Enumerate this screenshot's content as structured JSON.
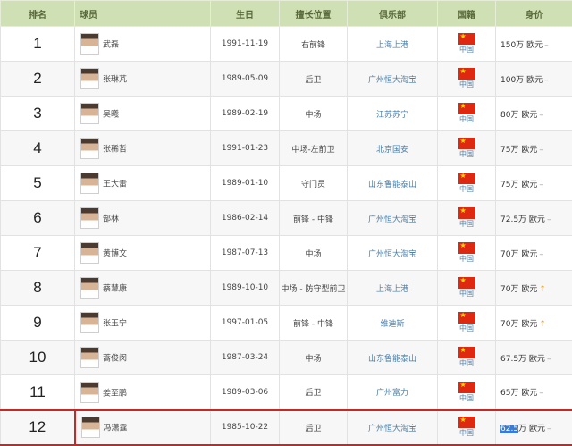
{
  "headers": [
    "排名",
    "球员",
    "生日",
    "擅长位置",
    "俱乐部",
    "国籍",
    "身价"
  ],
  "players": [
    {
      "rank": "1",
      "name": "武磊",
      "dob": "1991-11-19",
      "position": "右前锋",
      "club": "上海上港",
      "nationality": "中国",
      "value": "150万",
      "currency": "欧元",
      "trend": "–",
      "trend_dir": "flat"
    },
    {
      "rank": "2",
      "name": "张琳芃",
      "dob": "1989-05-09",
      "position": "后卫",
      "club": "广州恒大淘宝",
      "nationality": "中国",
      "value": "100万",
      "currency": "欧元",
      "trend": "–",
      "trend_dir": "flat"
    },
    {
      "rank": "3",
      "name": "吴曦",
      "dob": "1989-02-19",
      "position": "中场",
      "club": "江苏苏宁",
      "nationality": "中国",
      "value": "80万",
      "currency": "欧元",
      "trend": "–",
      "trend_dir": "flat"
    },
    {
      "rank": "4",
      "name": "张稀哲",
      "dob": "1991-01-23",
      "position": "中场-左前卫",
      "club": "北京国安",
      "nationality": "中国",
      "value": "75万",
      "currency": "欧元",
      "trend": "–",
      "trend_dir": "flat"
    },
    {
      "rank": "5",
      "name": "王大雷",
      "dob": "1989-01-10",
      "position": "守门员",
      "club": "山东鲁能泰山",
      "nationality": "中国",
      "value": "75万",
      "currency": "欧元",
      "trend": "–",
      "trend_dir": "flat"
    },
    {
      "rank": "6",
      "name": "郜林",
      "dob": "1986-02-14",
      "position": "前锋 - 中锋",
      "club": "广州恒大淘宝",
      "nationality": "中国",
      "value": "72.5万",
      "currency": "欧元",
      "trend": "–",
      "trend_dir": "flat"
    },
    {
      "rank": "7",
      "name": "黄博文",
      "dob": "1987-07-13",
      "position": "中场",
      "club": "广州恒大淘宝",
      "nationality": "中国",
      "value": "70万",
      "currency": "欧元",
      "trend": "–",
      "trend_dir": "flat"
    },
    {
      "rank": "8",
      "name": "蔡慧康",
      "dob": "1989-10-10",
      "position": "中场 - 防守型前卫",
      "club": "上海上港",
      "nationality": "中国",
      "value": "70万",
      "currency": "欧元",
      "trend": "↑",
      "trend_dir": "up"
    },
    {
      "rank": "9",
      "name": "张玉宁",
      "dob": "1997-01-05",
      "position": "前锋 - 中锋",
      "club": "维迪斯",
      "nationality": "中国",
      "value": "70万",
      "currency": "欧元",
      "trend": "↑",
      "trend_dir": "up"
    },
    {
      "rank": "10",
      "name": "蒿俊闵",
      "dob": "1987-03-24",
      "position": "中场",
      "club": "山东鲁能泰山",
      "nationality": "中国",
      "value": "67.5万",
      "currency": "欧元",
      "trend": "–",
      "trend_dir": "flat"
    },
    {
      "rank": "11",
      "name": "姜至鹏",
      "dob": "1989-03-06",
      "position": "后卫",
      "club": "广州富力",
      "nationality": "中国",
      "value": "65万",
      "currency": "欧元",
      "trend": "–",
      "trend_dir": "flat"
    },
    {
      "rank": "12",
      "name": "冯潇霆",
      "dob": "1985-10-22",
      "position": "后卫",
      "club": "广州恒大淘宝",
      "nationality": "中国",
      "value": "62.5万",
      "currency": "欧元",
      "trend": "–",
      "trend_dir": "flat",
      "highlighted": true,
      "selected_value_part": "62.5",
      "value_suffix": "万"
    }
  ],
  "colors": {
    "header_bg": "#cfe0b4",
    "link": "#4d7fa8",
    "highlight_border": "#c62828",
    "selection": "#3b7bd0"
  },
  "icons": {
    "avatar": "player-photo",
    "flag": "china-flag-icon",
    "trend_flat": "dash",
    "trend_up": "arrow-up-icon"
  }
}
